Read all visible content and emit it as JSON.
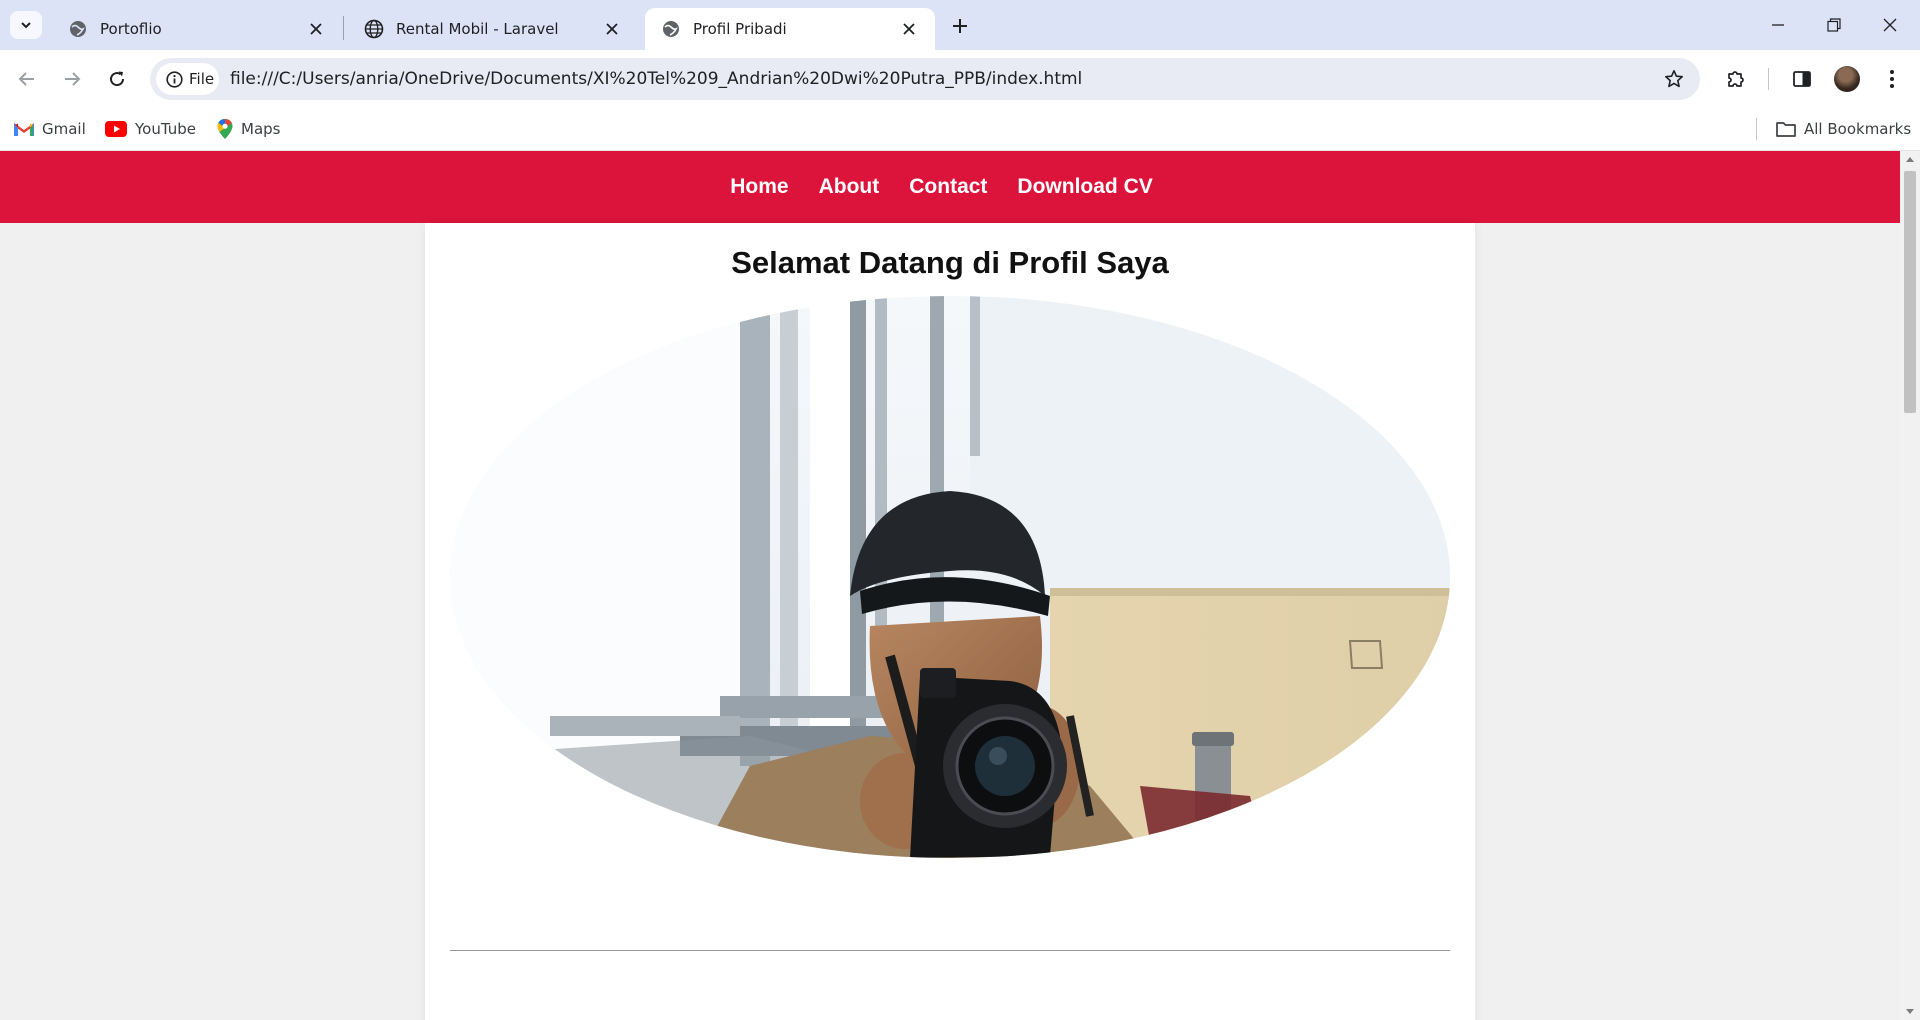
{
  "browser": {
    "tabs": [
      {
        "title": "Portoflio",
        "active": false
      },
      {
        "title": "Rental Mobil - Laravel",
        "active": false
      },
      {
        "title": "Profil Pribadi",
        "active": true
      }
    ],
    "site_chip": "File",
    "url": "file:///C:/Users/anria/OneDrive/Documents/XI%20Tel%209_Andrian%20Dwi%20Putra_PPB/index.html",
    "bookmarks": [
      {
        "label": "Gmail",
        "icon": "gmail-icon"
      },
      {
        "label": "YouTube",
        "icon": "youtube-icon"
      },
      {
        "label": "Maps",
        "icon": "maps-icon"
      }
    ],
    "all_bookmarks": "All Bookmarks",
    "accent": "#dde3f7"
  },
  "page": {
    "nav": {
      "items": [
        "Home",
        "About",
        "Contact",
        "Download CV"
      ],
      "background": "#dc143c"
    },
    "heading": "Selamat Datang di Profil Saya",
    "photo_icon": "profile-photo"
  }
}
